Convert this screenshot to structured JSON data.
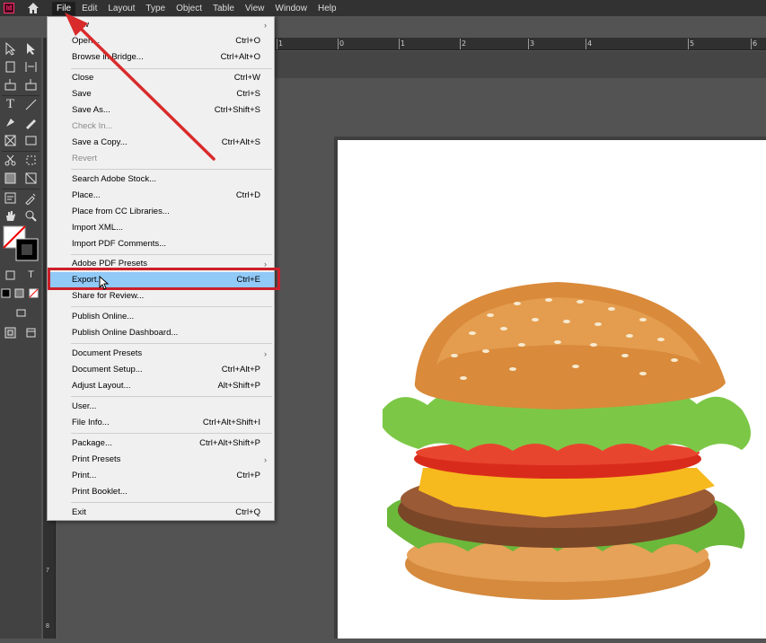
{
  "menubar": {
    "app_icon": "Id",
    "home_icon": "home-icon",
    "items": [
      "File",
      "Edit",
      "Layout",
      "Type",
      "Object",
      "Table",
      "View",
      "Window",
      "Help"
    ]
  },
  "rulers": {
    "h_labels": [
      "1",
      "0",
      "1",
      "2",
      "3",
      "4",
      "5",
      "6"
    ],
    "v_labels": [
      "7",
      "8"
    ]
  },
  "file_menu": {
    "items": [
      {
        "label": "New",
        "shortcut": "",
        "submenu": true
      },
      {
        "label": "Open...",
        "shortcut": "Ctrl+O"
      },
      {
        "label": "Browse in Bridge...",
        "shortcut": "Ctrl+Alt+O"
      },
      {
        "label": "Close",
        "shortcut": "Ctrl+W"
      },
      {
        "label": "Save",
        "shortcut": "Ctrl+S"
      },
      {
        "label": "Save As...",
        "shortcut": "Ctrl+Shift+S"
      },
      {
        "label": "Check In...",
        "shortcut": "",
        "disabled": true
      },
      {
        "label": "Save a Copy...",
        "shortcut": "Ctrl+Alt+S"
      },
      {
        "label": "Revert",
        "shortcut": "",
        "disabled": true
      },
      {
        "label": "Search Adobe Stock...",
        "shortcut": ""
      },
      {
        "label": "Place...",
        "shortcut": "Ctrl+D"
      },
      {
        "label": "Place from CC Libraries...",
        "shortcut": ""
      },
      {
        "label": "Import XML...",
        "shortcut": ""
      },
      {
        "label": "Import PDF Comments...",
        "shortcut": ""
      },
      {
        "label": "Adobe PDF Presets",
        "shortcut": "",
        "submenu": true
      },
      {
        "label": "Export...",
        "shortcut": "Ctrl+E",
        "highlighted": true
      },
      {
        "label": "Share for Review...",
        "shortcut": ""
      },
      {
        "label": "Publish Online...",
        "shortcut": ""
      },
      {
        "label": "Publish Online Dashboard...",
        "shortcut": ""
      },
      {
        "label": "Document Presets",
        "shortcut": "",
        "submenu": true
      },
      {
        "label": "Document Setup...",
        "shortcut": "Ctrl+Alt+P"
      },
      {
        "label": "Adjust Layout...",
        "shortcut": "Alt+Shift+P"
      },
      {
        "label": "User...",
        "shortcut": ""
      },
      {
        "label": "File Info...",
        "shortcut": "Ctrl+Alt+Shift+I"
      },
      {
        "label": "Package...",
        "shortcut": "Ctrl+Alt+Shift+P"
      },
      {
        "label": "Print Presets",
        "shortcut": "",
        "submenu": true
      },
      {
        "label": "Print...",
        "shortcut": "Ctrl+P"
      },
      {
        "label": "Print Booklet...",
        "shortcut": ""
      },
      {
        "label": "Exit",
        "shortcut": "Ctrl+Q"
      }
    ]
  },
  "colors": {
    "highlight": "#91c9f7",
    "annotation_red": "#cc1f2a",
    "menubar_bg": "#323232",
    "workspace_bg": "#535353"
  },
  "canvas": {
    "image": "burger-image"
  }
}
